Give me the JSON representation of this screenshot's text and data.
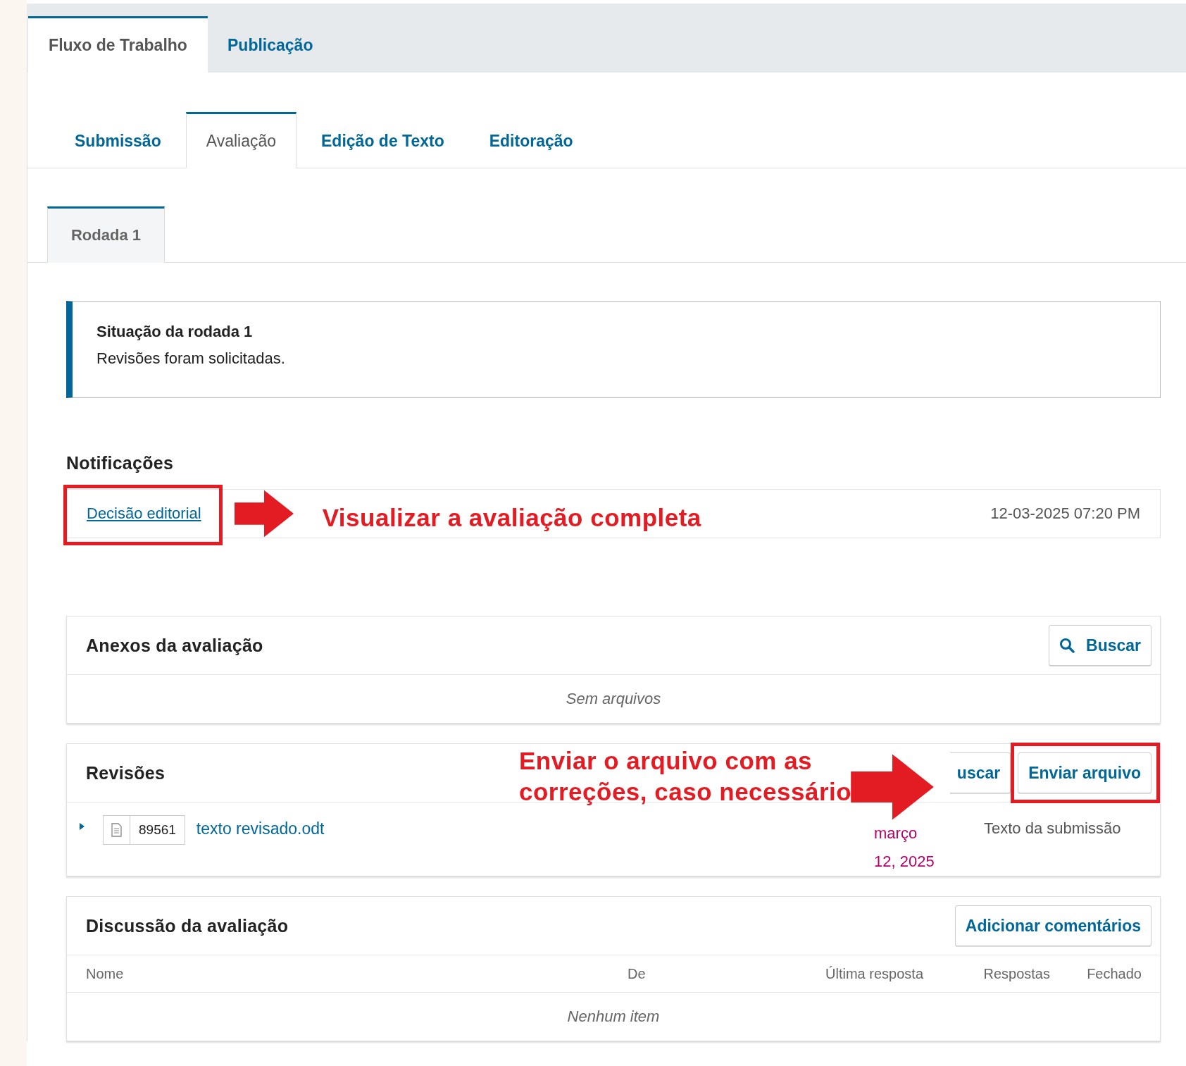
{
  "top_tabs": [
    {
      "label": "Fluxo de Trabalho",
      "selected": true
    },
    {
      "label": "Publicação",
      "selected": false
    }
  ],
  "stage_tabs": [
    {
      "label": "Submissão",
      "selected": false
    },
    {
      "label": "Avaliação",
      "selected": true
    },
    {
      "label": "Edição de Texto",
      "selected": false
    },
    {
      "label": "Editoração",
      "selected": false
    }
  ],
  "round_tabs": [
    {
      "label": "Rodada 1",
      "selected": true
    }
  ],
  "round_status": {
    "title": "Situação da rodada 1",
    "message": "Revisões foram solicitadas."
  },
  "notifications": {
    "heading": "Notificações",
    "items": [
      {
        "link": "Decisão editorial",
        "date": "12-03-2025 07:20 PM",
        "highlighted": true
      }
    ]
  },
  "review_attachments": {
    "title": "Anexos da avaliação",
    "buttons": [
      {
        "label": "Buscar",
        "kind": "search",
        "highlighted": false
      }
    ],
    "empty": "Sem arquivos"
  },
  "revisions": {
    "title": "Revisões",
    "buttons": [
      {
        "label": "uscar",
        "kind": "search-covered",
        "highlighted": false
      },
      {
        "label": "Enviar arquivo",
        "kind": "plain",
        "highlighted": true
      }
    ],
    "files": [
      {
        "id": "89561",
        "name": "texto revisado.odt",
        "date": "março 12, 2025",
        "type": "Texto da submissão",
        "expanded": false
      }
    ]
  },
  "discussion": {
    "title": "Discussão da avaliação",
    "buttons": [
      {
        "label": "Adicionar comentários",
        "kind": "plain",
        "highlighted": false
      }
    ],
    "columns": [
      "Nome",
      "De",
      "Última resposta",
      "Respostas",
      "Fechado"
    ],
    "empty": "Nenhum item"
  },
  "annotations": [
    {
      "lines": [
        "Visualizar a avaliação completa"
      ]
    },
    {
      "lines": [
        "Enviar o arquivo com as",
        "correções, caso necessário"
      ]
    }
  ]
}
